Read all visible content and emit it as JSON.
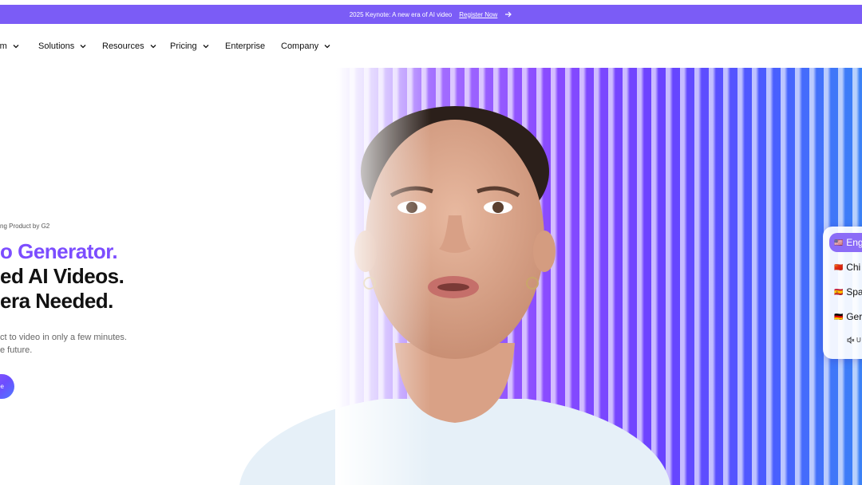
{
  "banner": {
    "text": "2025 Keynote: A new era of AI video",
    "link": "Register Now"
  },
  "nav": {
    "items": [
      {
        "label": "rm",
        "has_dropdown": true
      },
      {
        "label": "Solutions",
        "has_dropdown": true
      },
      {
        "label": "Resources",
        "has_dropdown": true
      },
      {
        "label": "Pricing",
        "has_dropdown": true
      },
      {
        "label": "Enterprise",
        "has_dropdown": false
      },
      {
        "label": "Company",
        "has_dropdown": true
      }
    ]
  },
  "hero": {
    "eyebrow": "ng Product by G2",
    "headline": {
      "line1": "o Generator.",
      "line2": "ed AI Videos.",
      "line3": "era Needed."
    },
    "subtitle": {
      "line1": "ct to video in only a few minutes.",
      "line2": "e future."
    },
    "cta_label": "ee"
  },
  "language_selector": {
    "items": [
      {
        "flag": "🇺🇸",
        "label": "Eng",
        "active": true
      },
      {
        "flag": "🇨🇳",
        "label": "Chi",
        "active": false
      },
      {
        "flag": "🇪🇸",
        "label": "Spa",
        "active": false
      },
      {
        "flag": "🇩🇪",
        "label": "Ger",
        "active": false
      }
    ],
    "mute_label": "U"
  },
  "colors": {
    "brand": "#7b5cf6",
    "headline_accent": "#7c4dff",
    "active_language": "#8b6cf7"
  }
}
